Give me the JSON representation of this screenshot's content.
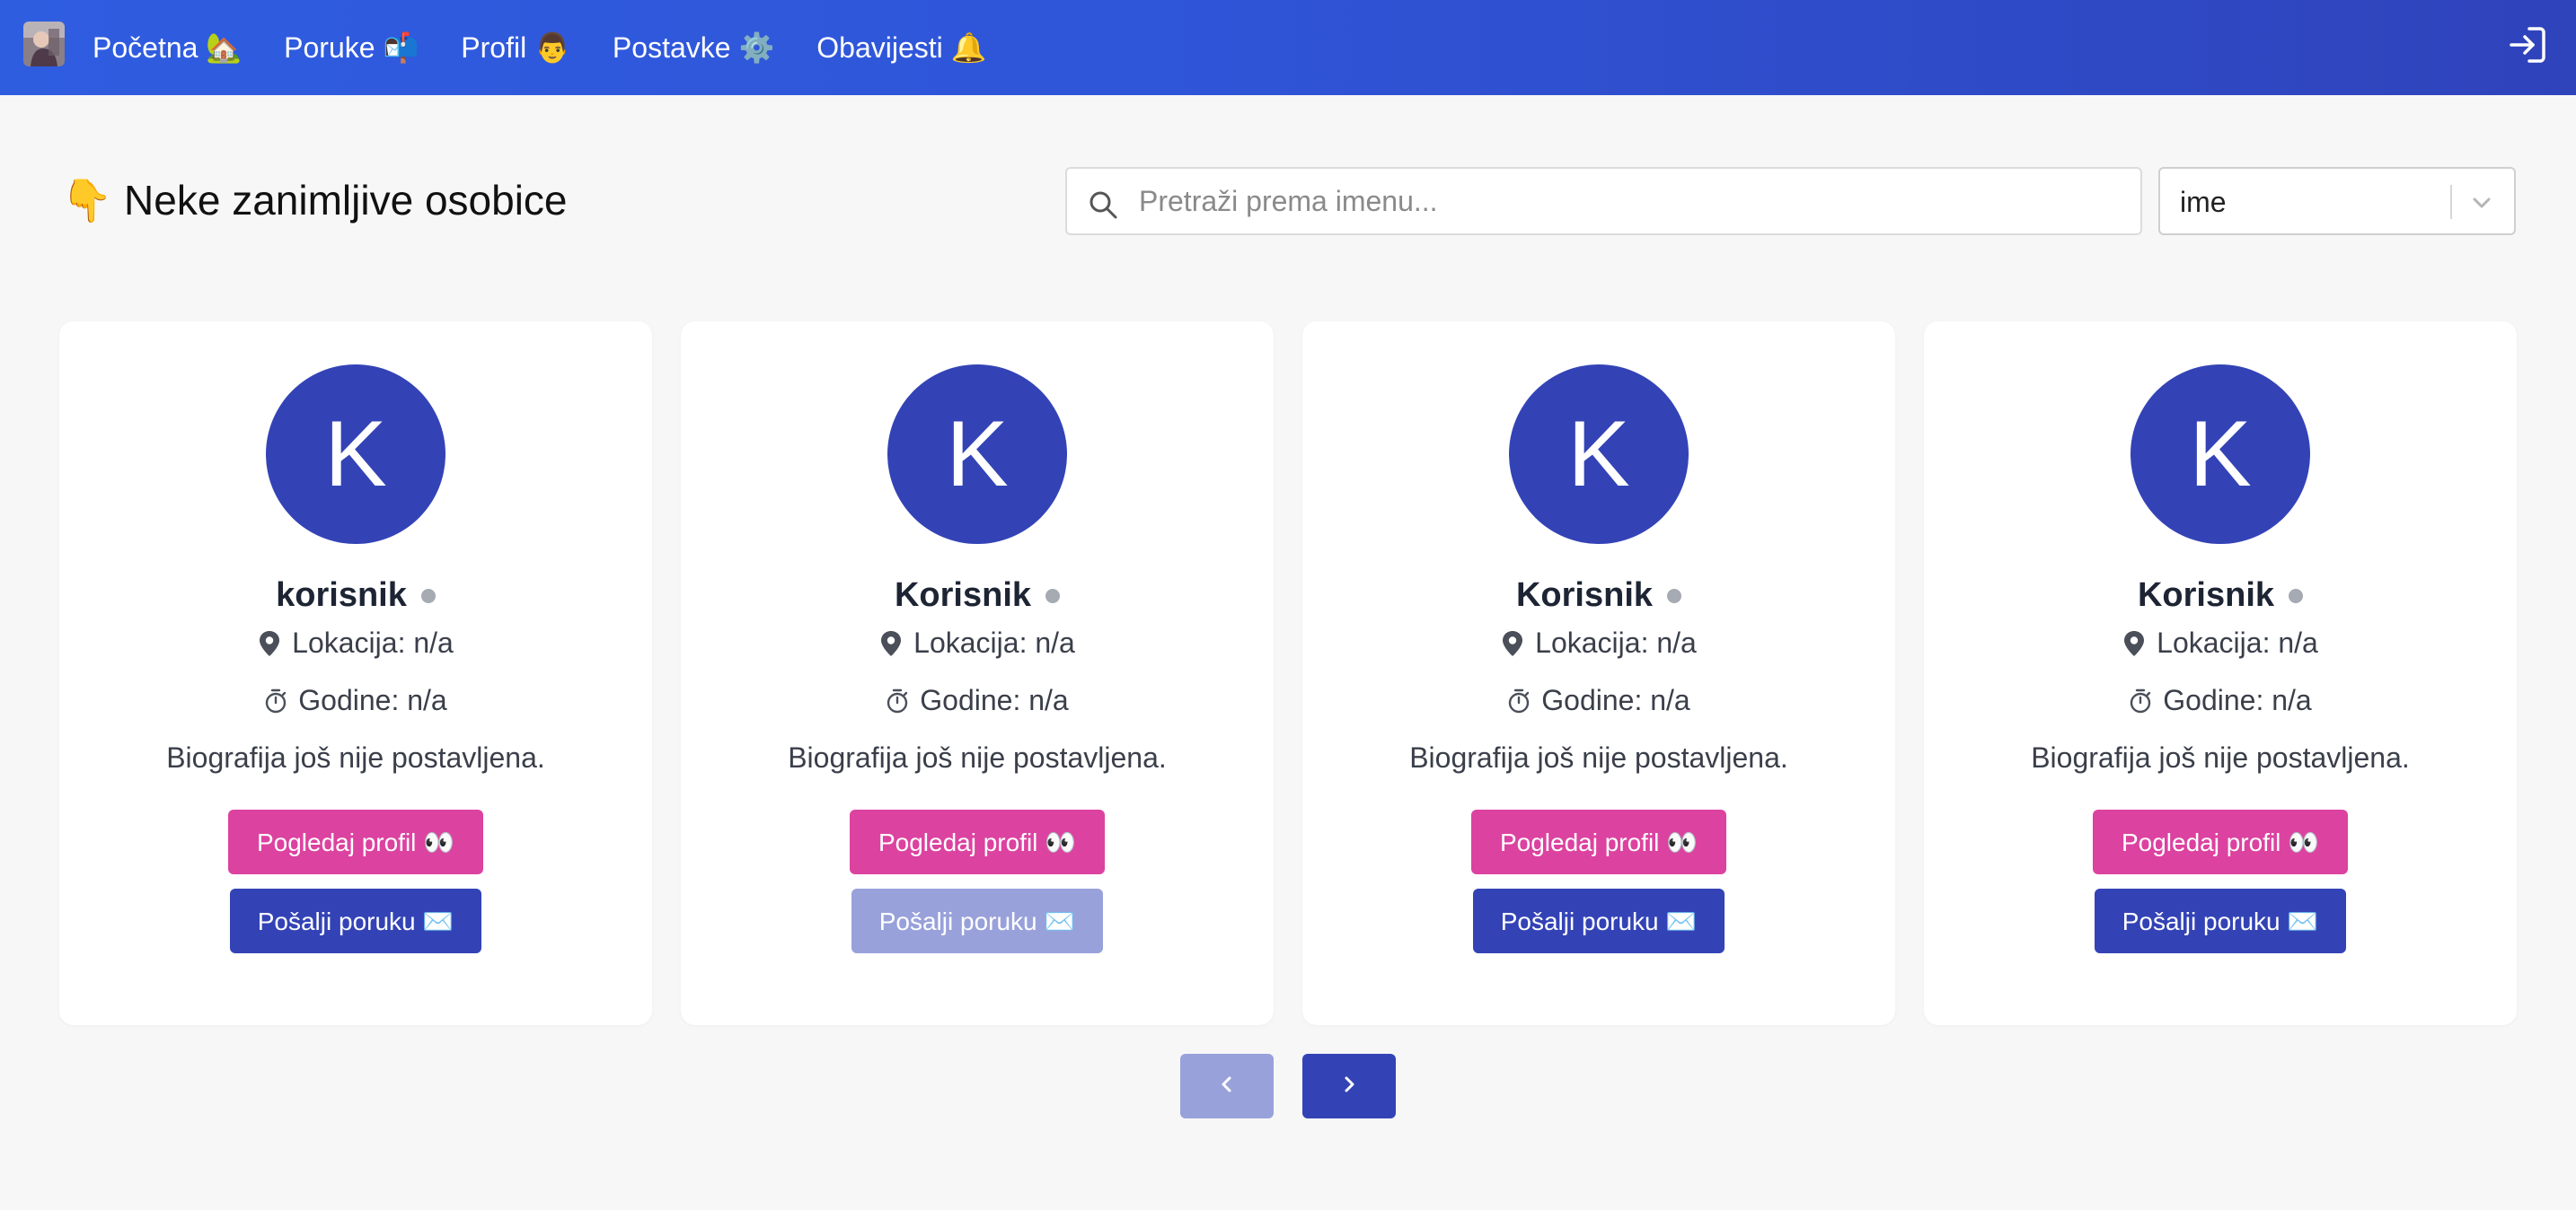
{
  "navbar": {
    "items": [
      {
        "label": "Početna 🏡"
      },
      {
        "label": "Poruke 📬"
      },
      {
        "label": "Profil 👨"
      },
      {
        "label": "Postavke ⚙️"
      },
      {
        "label": "Obavijesti 🔔"
      }
    ],
    "logout_icon": "logout-icon",
    "background": "#2f55d8"
  },
  "header": {
    "title": "👇 Neke zanimljive osobice"
  },
  "search": {
    "placeholder": "Pretraži prema imenu...",
    "value": ""
  },
  "sort": {
    "selected": "ime"
  },
  "cards": [
    {
      "initial": "K",
      "name": "korisnik",
      "location": "Lokacija: n/a",
      "age": "Godine: n/a",
      "bio": "Biografija još nije postavljena.",
      "view_label": "Pogledaj profil 👀",
      "message_label": "Pošalji poruku ✉️",
      "message_disabled": false
    },
    {
      "initial": "K",
      "name": "Korisnik",
      "location": "Lokacija: n/a",
      "age": "Godine: n/a",
      "bio": "Biografija još nije postavljena.",
      "view_label": "Pogledaj profil 👀",
      "message_label": "Pošalji poruku ✉️",
      "message_disabled": true
    },
    {
      "initial": "K",
      "name": "Korisnik",
      "location": "Lokacija: n/a",
      "age": "Godine: n/a",
      "bio": "Biografija još nije postavljena.",
      "view_label": "Pogledaj profil 👀",
      "message_label": "Pošalji poruku ✉️",
      "message_disabled": false
    },
    {
      "initial": "K",
      "name": "Korisnik",
      "location": "Lokacija: n/a",
      "age": "Godine: n/a",
      "bio": "Biografija još nije postavljena.",
      "view_label": "Pogledaj profil 👀",
      "message_label": "Pošalji poruku ✉️",
      "message_disabled": false
    }
  ],
  "pagination": {
    "prev_icon": "chevron-left-icon",
    "next_icon": "chevron-right-icon",
    "prev_disabled": true
  },
  "colors": {
    "avatar": "#3343b6",
    "view_button": "#dc42a0",
    "message_button": "#3343b6",
    "disabled_button": "#99a1db"
  }
}
